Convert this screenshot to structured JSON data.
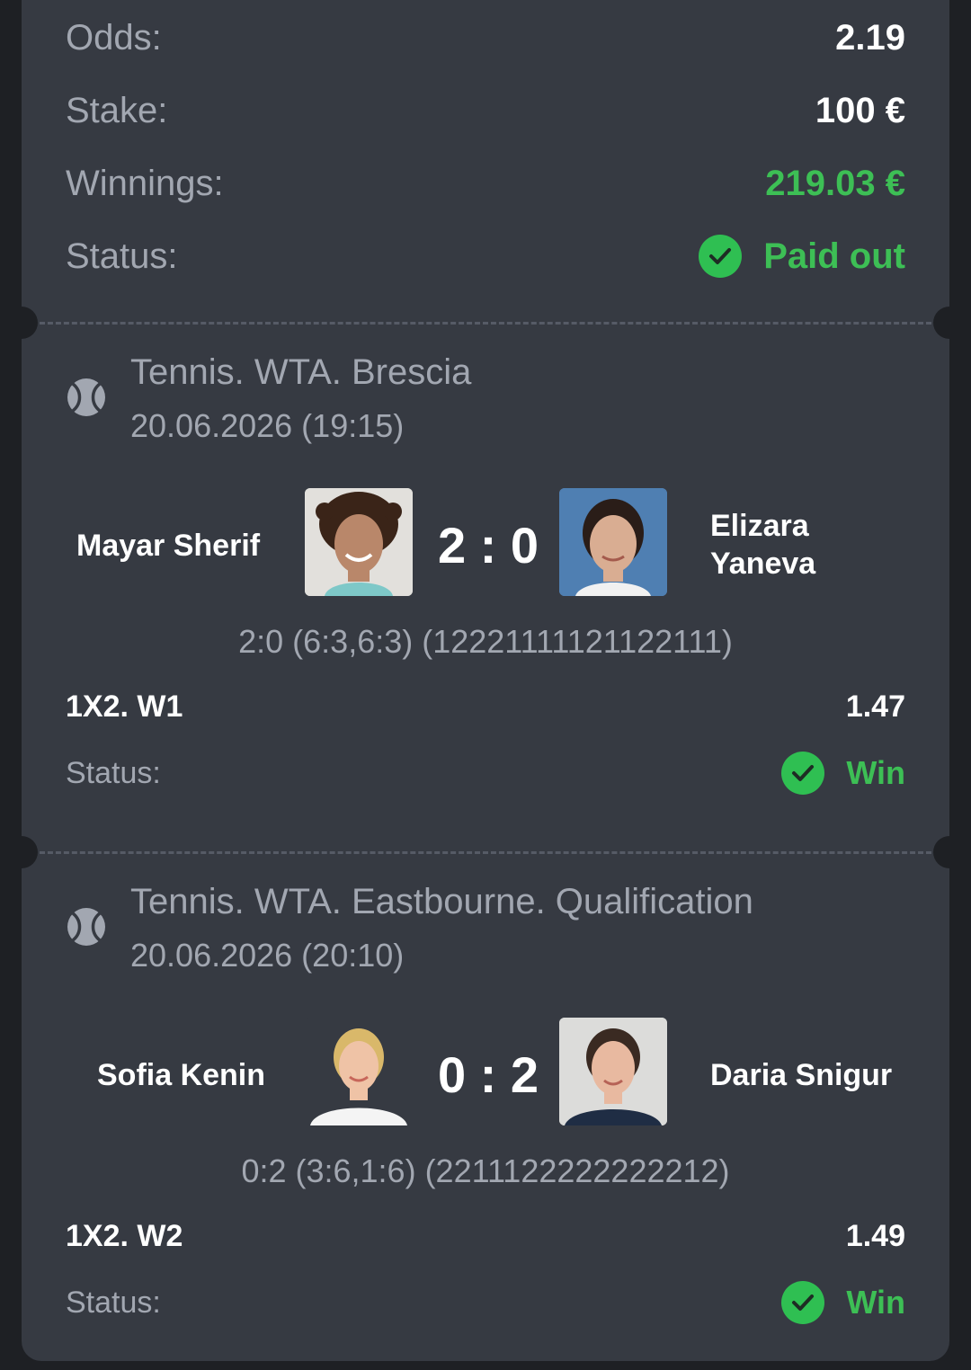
{
  "summary": {
    "odds_label": "Odds:",
    "odds_value": "2.19",
    "stake_label": "Stake:",
    "stake_value": "100 €",
    "winnings_label": "Winnings:",
    "winnings_value": "219.03 €",
    "status_label": "Status:",
    "status_value": "Paid out"
  },
  "colors": {
    "card_bg": "#363a42",
    "page_bg": "#1e2024",
    "success": "#3dbf55",
    "muted_text": "#a2a7b1",
    "primary_text": "#ffffff"
  },
  "events": [
    {
      "icon": "tennis-ball-icon",
      "title": "Tennis. WTA. Brescia",
      "date": "20.06.2026 (19:15)",
      "player1": "Mayar Sherif",
      "player2_line1": "Elizara",
      "player2_line2": "Yaneva",
      "score": "2 : 0",
      "detail": "2:0 (6:3,6:3) (12221111121122111)",
      "market": "1X2. W1",
      "odds": "1.47",
      "status_label": "Status:",
      "status_value": "Win"
    },
    {
      "icon": "tennis-ball-icon",
      "title": "Tennis. WTA. Eastbourne. Qualification",
      "date": "20.06.2026 (20:10)",
      "player1": "Sofia Kenin",
      "player2": "Daria Snigur",
      "score": "0 : 2",
      "detail": "0:2 (3:6,1:6) (2211122222222212)",
      "market": "1X2. W2",
      "odds": "1.49",
      "status_label": "Status:",
      "status_value": "Win"
    }
  ]
}
